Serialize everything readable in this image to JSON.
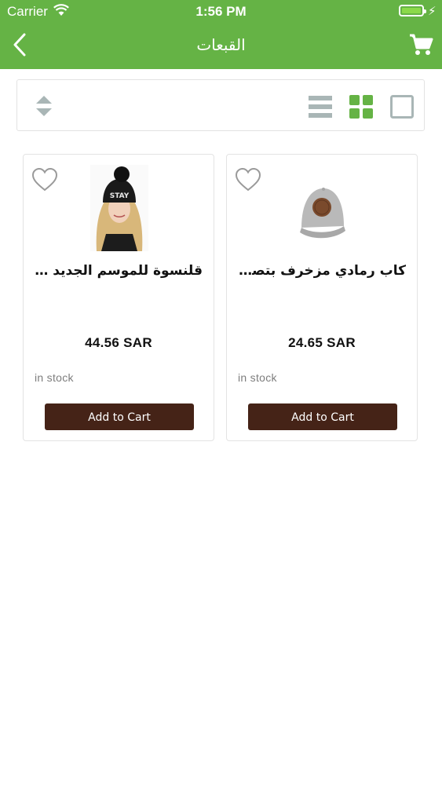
{
  "status_bar": {
    "carrier": "Carrier",
    "time": "1:56 PM",
    "battery_color": "#8bd94a"
  },
  "header": {
    "title": "القبعات",
    "back_icon": "chevron-left-icon",
    "cart_icon": "shopping-cart-icon",
    "background_color": "#65b345"
  },
  "toolbar": {
    "sort_icon": "sort-updown-icon",
    "views": [
      {
        "icon": "list-view-icon",
        "active": false
      },
      {
        "icon": "grid-view-icon",
        "active": true
      },
      {
        "icon": "single-view-icon",
        "active": false
      }
    ],
    "active_color": "#65b345",
    "inactive_color": "#a9b6b6"
  },
  "products": [
    {
      "name": "قلنسوة للموسم الجديد بكرة...",
      "price": "44.56 SAR",
      "stock": "in stock",
      "button": "Add to Cart",
      "image": "woman-beanie-photo"
    },
    {
      "name": "كاب رمادي مزخرف بتصميم",
      "price": "24.65 SAR",
      "stock": "in stock",
      "button": "Add to Cart",
      "image": "gray-cap-photo"
    }
  ],
  "button_color": "#452317"
}
